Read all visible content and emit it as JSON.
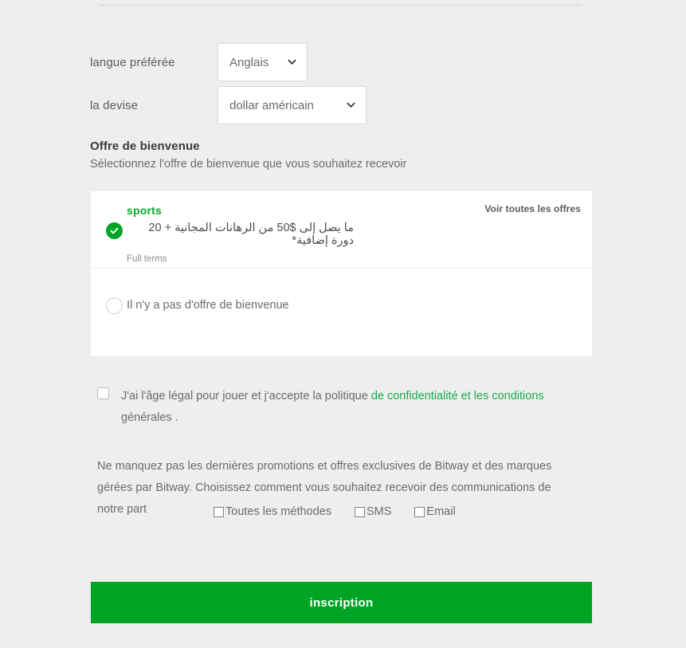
{
  "form": {
    "language": {
      "label": "langue préférée",
      "value": "Anglais",
      "icon": "chevron-down-icon"
    },
    "currency": {
      "label": "la devise",
      "value": "dollar américain",
      "icon": "chevron-down-icon"
    }
  },
  "welcome_offer": {
    "heading": "Offre de bienvenue",
    "subheading": "Sélectionnez l'offre de bienvenue que vous souhaitez recevoir",
    "see_all_link": "Voir toutes les offres",
    "options": [
      {
        "selected": true,
        "brand": "sports",
        "description": "ما يصل إلى $50 من الرهانات المجانية + 20 دورة إضافية*",
        "terms_link": "Full terms",
        "icon": "check-circle-icon"
      },
      {
        "selected": false,
        "label": "Il n'y a pas d'offre de bienvenue",
        "icon": "radio-empty-icon"
      }
    ]
  },
  "terms": {
    "checked": false,
    "text_before": "J'ai l'âge légal pour jouer et j'accepte la politique ",
    "link_text": "de confidentialité et les conditions",
    "text_after": " générales ."
  },
  "marketing": {
    "text": "Ne manquez pas les dernières promotions et offres exclusives de Bitway et des marques gérées par Bitway. Choisissez comment vous souhaitez recevoir des communications de notre part",
    "methods": [
      {
        "label": "Toutes les méthodes",
        "checked": false
      },
      {
        "label": "SMS",
        "checked": false
      },
      {
        "label": "Email",
        "checked": false
      }
    ]
  },
  "submit": {
    "label": "inscription"
  },
  "colors": {
    "page_background": "#eeeeee",
    "brand_green": "#00a425",
    "link_green": "#1dab4a",
    "card_background": "#ffffff",
    "text_gray": "#6b6b6b"
  }
}
